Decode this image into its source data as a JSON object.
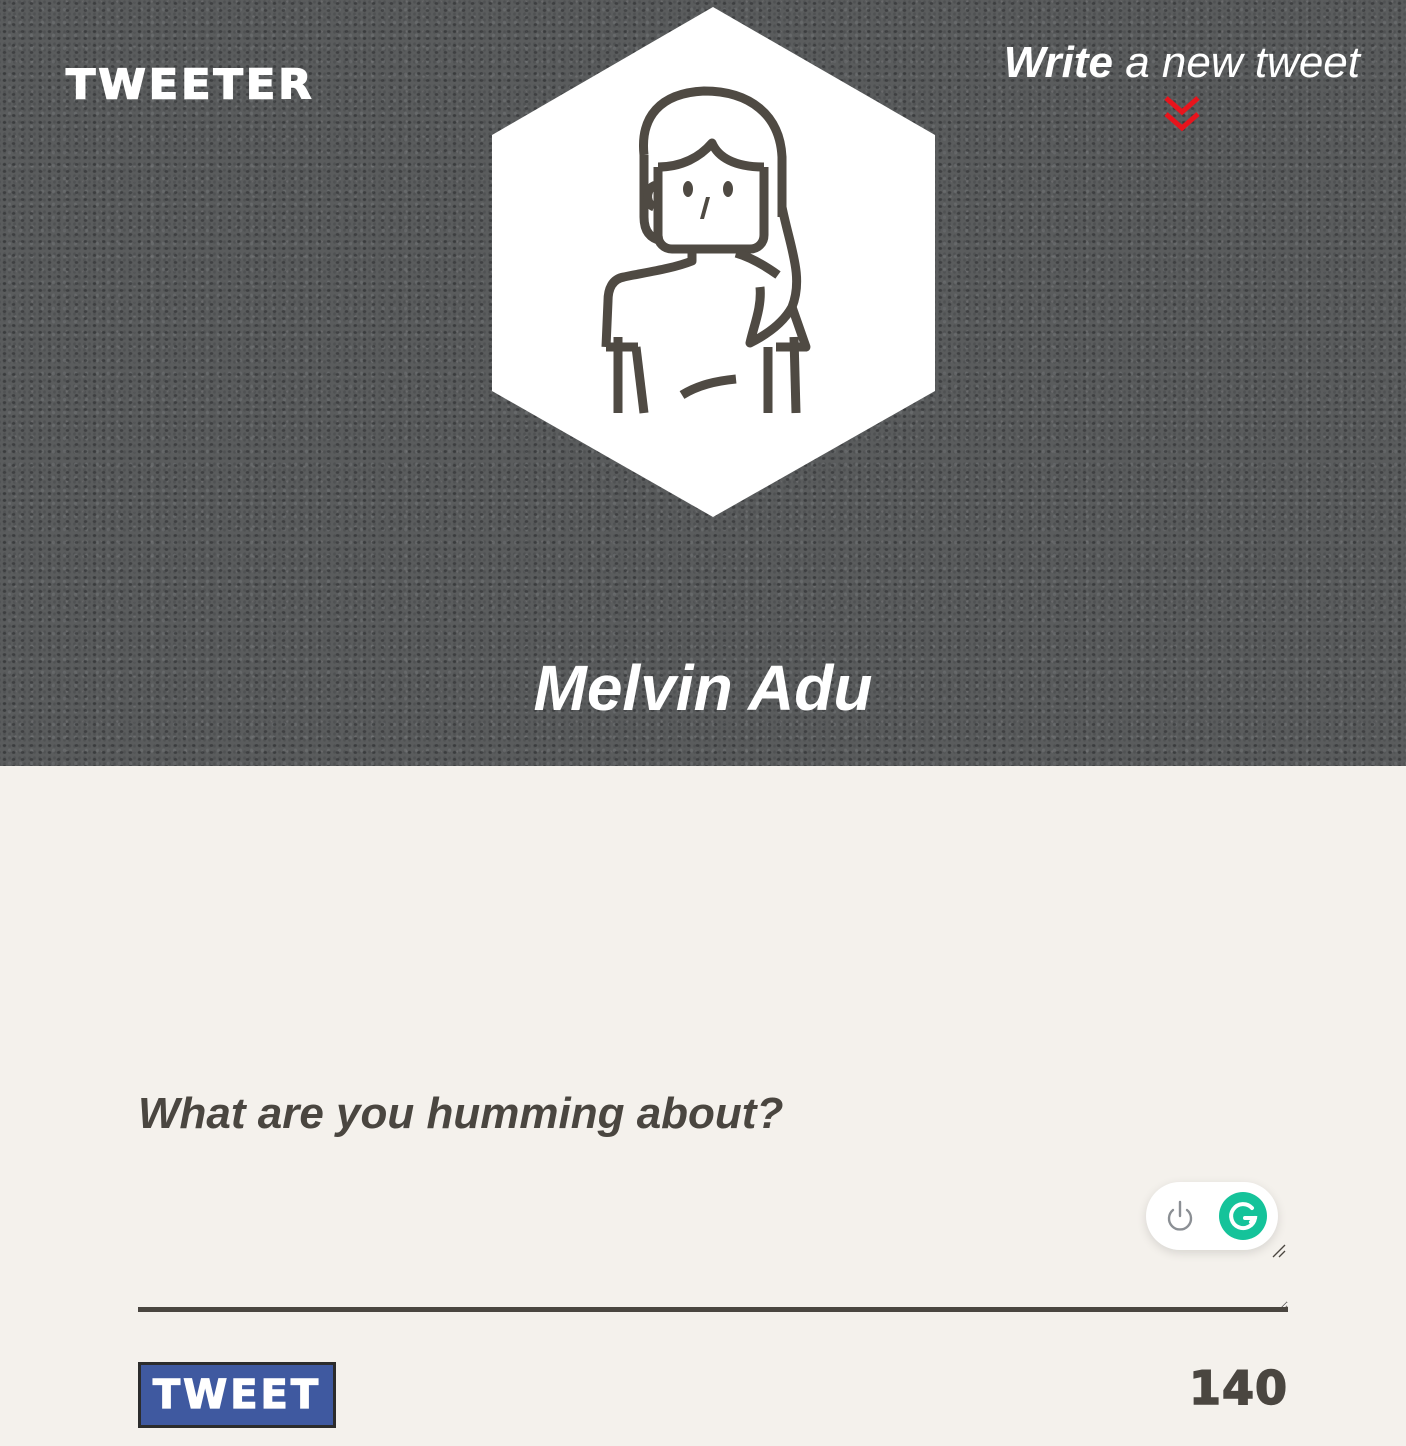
{
  "header": {
    "brand": "TWEETER",
    "write_link": {
      "strong": "Write",
      "rest": " a new tweet"
    },
    "user_name": "Melvin Adu",
    "colors": {
      "background": "#5a5c5d",
      "chevron": "#e8141c"
    },
    "avatar_icon": "woman-avatar-icon",
    "chevron_icon": "double-chevron-down-icon"
  },
  "compose": {
    "placeholder": "What are you humming about?",
    "value": "",
    "tweet_button": "TWEET",
    "char_count": "140",
    "button_color": "#3f59a0"
  },
  "grammarly": {
    "power_icon": "power-icon",
    "logo_icon": "grammarly-g-icon",
    "color": "#15c39a"
  }
}
